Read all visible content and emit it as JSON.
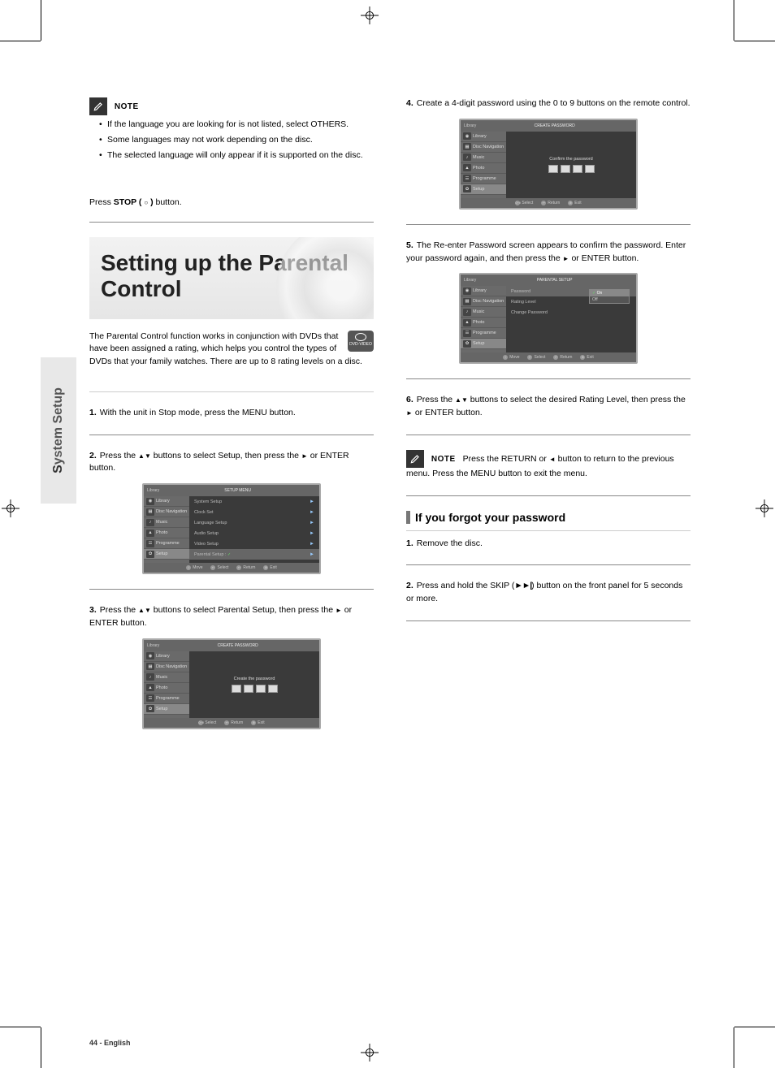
{
  "sideTab": {
    "prefix": "S",
    "rest": "ystem Setup"
  },
  "left": {
    "noteLabel": "NOTE",
    "noteBullets": [
      "If the language you are looking for is not listed, select OTHERS.",
      "Some languages may not work depending on the disc.",
      "The selected language will only appear if it is supported on the disc."
    ],
    "stopHint": {
      "prefix": "Press ",
      "btn": "STOP ( ",
      "btnGlyph": "■",
      "btnEnd": " )",
      "suffix": " button.",
      "glyph": "○"
    },
    "titleLine1": "Setting up the Parental",
    "titleLine2": "Control",
    "intro": "The Parental Control function works in conjunction with DVDs that have been assigned a rating, which helps you control the types of DVDs that your family watches. There are up to 8 rating levels on a disc.",
    "dvdBadge": "DVD-VIDEO",
    "step1": {
      "num": "1.",
      "text": "With the unit in Stop mode, press the MENU button."
    },
    "step2": {
      "num": "2.",
      "prefix": "Press the ",
      "glyph1": "▲▼",
      "mid": " buttons to select Setup, then press the ",
      "glyph2": "►",
      "suffix": " or ENTER button."
    },
    "step3": {
      "num": "3.",
      "prefix": "Press the ",
      "glyph1": "▲▼",
      "mid": " buttons to select Parental Setup, then press the ",
      "glyph2": "►",
      "suffix": " or ENTER button."
    },
    "ss1": {
      "headerLeft": "Library",
      "headerCenter": "SETUP MENU",
      "side": [
        "Library",
        "Disc Navigation",
        "Music",
        "Photo",
        "Programme",
        "Setup"
      ],
      "main": [
        {
          "label": "System Setup",
          "arrow": "►"
        },
        {
          "label": "Clock Set",
          "arrow": "►"
        },
        {
          "label": "Language Setup",
          "arrow": "►"
        },
        {
          "label": "Audio Setup",
          "arrow": "►"
        },
        {
          "label": "Video Setup",
          "arrow": "►",
          "sel": false
        },
        {
          "label": "Parental Setup :",
          "arrow": "►",
          "sel": true,
          "checked": true
        }
      ],
      "footer": [
        "Move",
        "Select",
        "Return",
        "Exit"
      ],
      "footerGlyphs": [
        "↕",
        "↵",
        "↩",
        "⊗"
      ],
      "sideSel": 5
    },
    "ss2": {
      "headerLeft": "Library",
      "headerCenter": "CREATE PASSWORD",
      "side": [
        "Library",
        "Disc Navigation",
        "Music",
        "Photo",
        "Programme",
        "Setup"
      ],
      "mainTitle": "Create the password",
      "footer": [
        "Select",
        "Return",
        "Exit"
      ],
      "footerGlyphs": [
        "0~9",
        "↩",
        "⊗"
      ],
      "sideSel": 5
    }
  },
  "right": {
    "step4": {
      "num": "4.",
      "text": "Create a 4-digit password using the 0 to 9 buttons on the remote control."
    },
    "step5": {
      "num": "5.",
      "prefix": "The Re-enter Password screen appears to confirm the password. Enter your password again, and then press the ",
      "glyph": "►",
      "suffix": " or ENTER button."
    },
    "step6": {
      "num": "6.",
      "prefix": "Press the ",
      "glyph1": "▲▼",
      "mid": " buttons to select the desired Rating Level, then press the ",
      "glyph2": "►",
      "suffix": " or ENTER button."
    },
    "noteLabel": "NOTE",
    "note": {
      "prefix": "Press the RETURN or ",
      "glyph": "◄",
      "suffix": " button to return to the previous menu. Press the MENU button to exit the menu."
    },
    "subsection": "If you forgot your password",
    "subStep1": {
      "num": "1.",
      "text": "Remove the disc."
    },
    "subStep2": {
      "num": "2.",
      "prefix": "Press and hold the SKIP (",
      "glyph": "►►|",
      "suffix": ") button on the front panel for 5 seconds or more."
    },
    "ss3": {
      "headerLeft": "Library",
      "headerCenter": "CREATE PASSWORD",
      "side": [
        "Library",
        "Disc Navigation",
        "Music",
        "Photo",
        "Programme",
        "Setup"
      ],
      "mainTitle": "Confirm the password",
      "footer": [
        "Select",
        "Return",
        "Exit"
      ],
      "footerGlyphs": [
        "0~9",
        "↩",
        "⊗"
      ],
      "sideSel": 5
    },
    "ss4": {
      "headerLeft": "Library",
      "headerCenter": "PARENTAL SETUP",
      "side": [
        "Library",
        "Disc Navigation",
        "Music",
        "Photo",
        "Programme",
        "Setup"
      ],
      "main": [
        {
          "label": "Password",
          "sel": true
        },
        {
          "label": "Rating Level"
        },
        {
          "label": "Change Password"
        }
      ],
      "dropdown": [
        {
          "t": "On",
          "sel": true,
          "check": true
        },
        {
          "t": "Off"
        }
      ],
      "footer": [
        "Move",
        "Select",
        "Return",
        "Exit"
      ],
      "footerGlyphs": [
        "↕",
        "↵",
        "↩",
        "⊗"
      ],
      "sideSel": 5
    }
  },
  "footer": "44 - English"
}
